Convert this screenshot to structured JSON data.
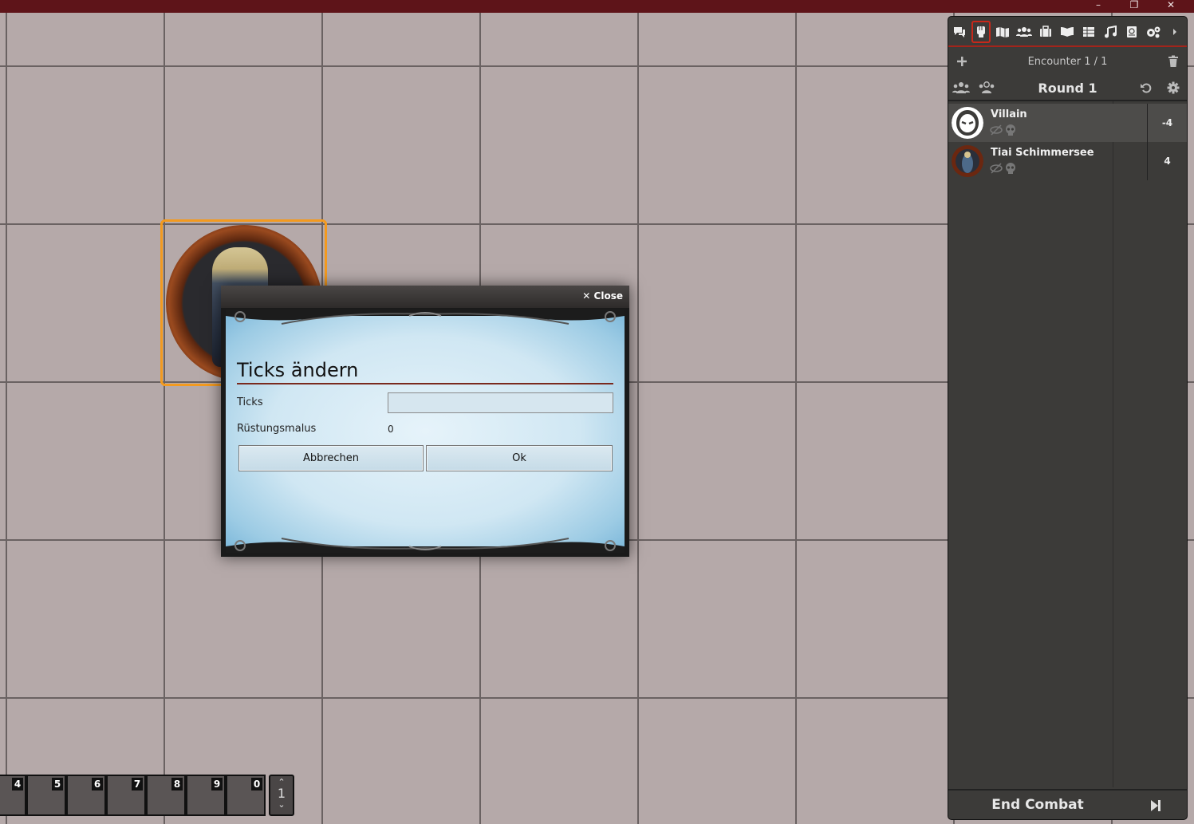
{
  "window": {
    "minimize": "–",
    "maximize": "❐",
    "close": "✕"
  },
  "dialog": {
    "close_label": "Close",
    "title": "Ticks ändern",
    "ticks_label": "Ticks",
    "ticks_value": "",
    "armor_label": "Rüstungsmalus",
    "armor_value": "0",
    "cancel_label": "Abbrechen",
    "ok_label": "Ok"
  },
  "hotbar": {
    "slots": [
      "4",
      "5",
      "6",
      "7",
      "8",
      "9",
      "0"
    ],
    "page": "1"
  },
  "sidebar": {
    "tabs": [
      "chat",
      "combat",
      "scenes",
      "actors",
      "items",
      "journal",
      "tables",
      "playlists",
      "compendium",
      "settings",
      "collapse"
    ],
    "active_tab": "combat",
    "encounter": "Encounter 1 / 1",
    "round": "Round 1",
    "combatants": [
      {
        "name": "Villain",
        "initiative": "-4"
      },
      {
        "name": "Tiai Schimmersee",
        "initiative": "4"
      }
    ],
    "end_combat": "End Combat"
  },
  "colors": {
    "accent": "#a3241b",
    "token_border": "#f39a1f",
    "titlebar": "#5e1419"
  }
}
